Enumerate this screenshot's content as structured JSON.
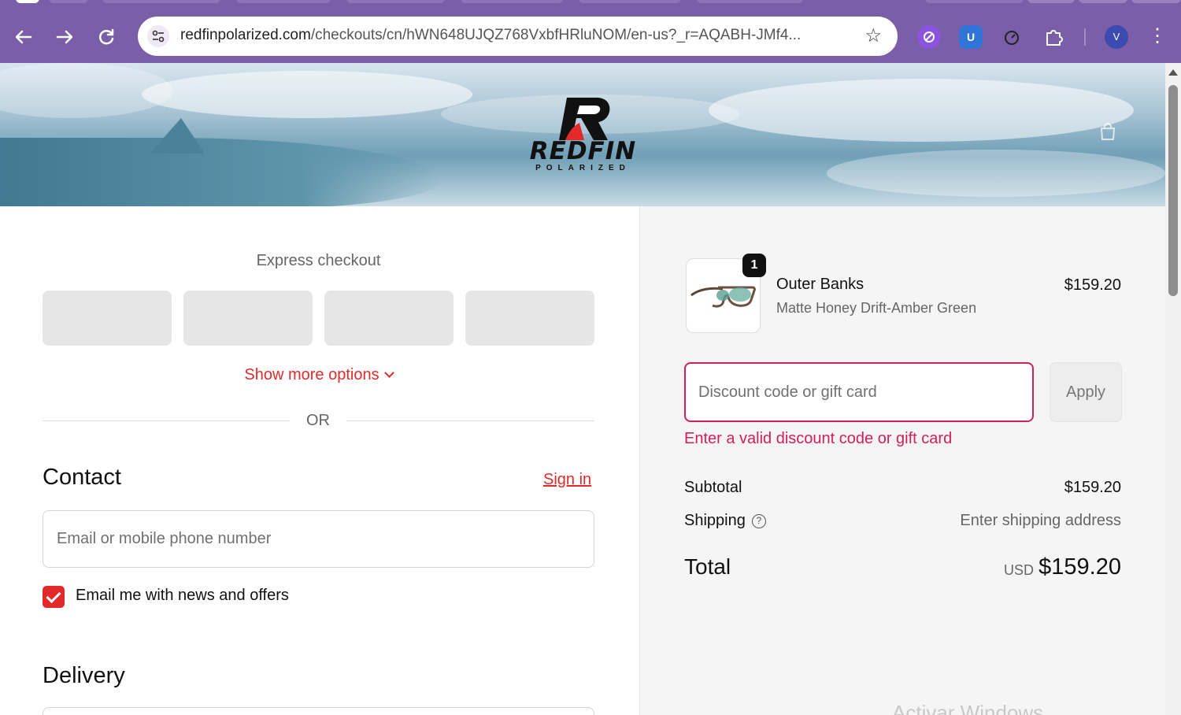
{
  "browser": {
    "url_host": "redfinpolarized.com",
    "url_path": "/checkouts/cn/hWN648UJQZ768VxbfHRluNOM/en-us?_r=AQABH-JMf4...",
    "profile_initial": "V",
    "icons": [
      "back-arrow-icon",
      "forward-arrow-icon",
      "reload-icon",
      "site-settings-icon",
      "star-icon",
      "extensions-icon",
      "menu-icon"
    ]
  },
  "brand": {
    "name": "REDFIN",
    "tagline": "POLARIZED",
    "accent_color": "#e22a2a"
  },
  "express": {
    "title": "Express checkout",
    "show_more": "Show more options",
    "or": "OR"
  },
  "contact": {
    "title": "Contact",
    "sign_in": "Sign in",
    "email_placeholder": "Email or mobile phone number",
    "newsletter_label": "Email me with news and offers",
    "newsletter_checked": true
  },
  "delivery": {
    "title": "Delivery"
  },
  "summary": {
    "item": {
      "quantity": "1",
      "name": "Outer Banks",
      "variant": "Matte Honey Drift-Amber Green",
      "price": "$159.20"
    },
    "discount_placeholder": "Discount code or gift card",
    "apply_label": "Apply",
    "discount_error": "Enter a valid discount code or gift card",
    "error_color": "#d21f5c",
    "subtotal_label": "Subtotal",
    "subtotal_value": "$159.20",
    "shipping_label": "Shipping",
    "shipping_value": "Enter shipping address",
    "total_label": "Total",
    "total_currency": "USD",
    "total_value": "$159.20"
  },
  "os_watermark": "Activar Windows"
}
